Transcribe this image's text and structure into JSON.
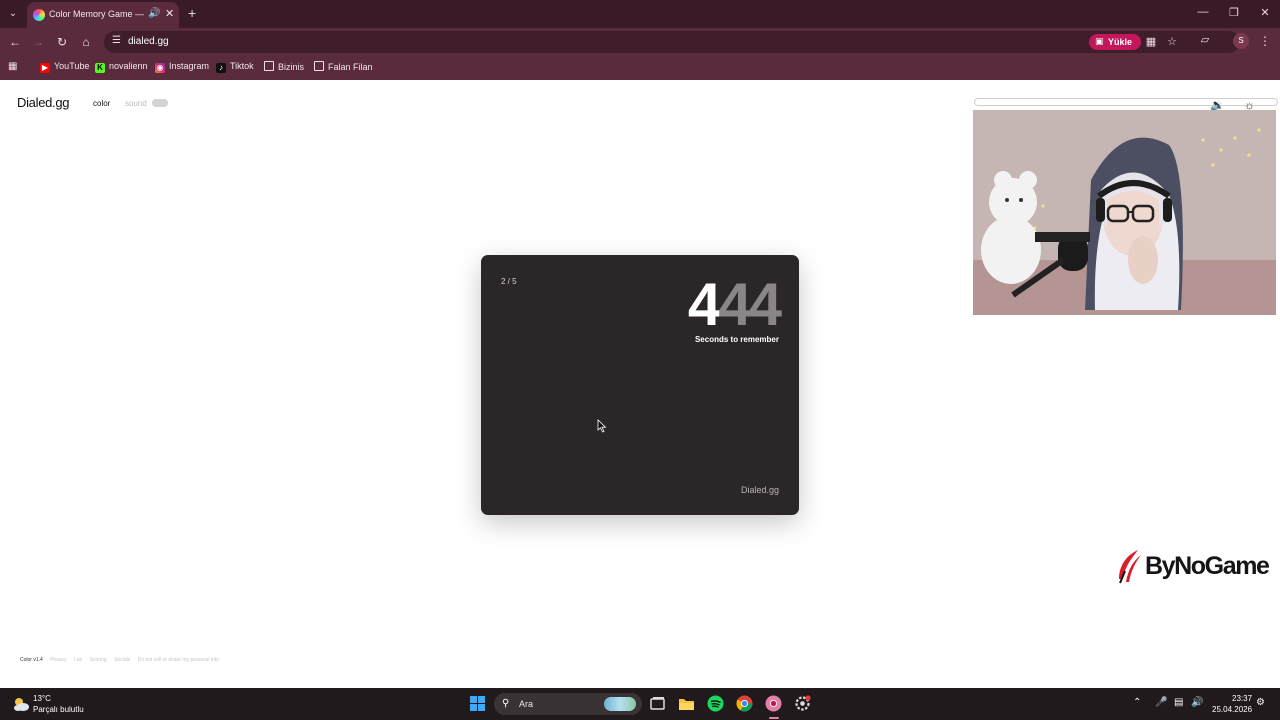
{
  "browser": {
    "tab_title": "Color Memory Game — Ho",
    "url": "dialed.gg",
    "yukle_label": "Yükle",
    "profile_initial": "S",
    "bookmarks": [
      {
        "label": "YouTube",
        "icon": "youtube-icon",
        "color": "#ff0000"
      },
      {
        "label": "novalienn",
        "icon": "kick-icon",
        "color": "#53fc18"
      },
      {
        "label": "Instagram",
        "icon": "instagram-icon",
        "color": "#e1306c"
      },
      {
        "label": "Tiktok",
        "icon": "tiktok-icon",
        "color": "#000000"
      },
      {
        "label": "Bizinis",
        "icon": "folder-icon",
        "color": "#f0e0e6"
      },
      {
        "label": "Falan Filan",
        "icon": "folder-icon",
        "color": "#f0e0e6"
      }
    ],
    "theme_color": "#5a2b3d",
    "accent_color": "#c2185b"
  },
  "page": {
    "logo": "Dialed.gg",
    "mode_color": "color",
    "mode_sound": "sound",
    "game": {
      "round": "2 / 5",
      "countdown_digits": [
        "4",
        "4",
        "4"
      ],
      "countdown_caption": "Seconds to remember",
      "brand": "Dialed.gg",
      "card_color": "#2b2628"
    },
    "footer": [
      "Color v1.4",
      "Privacy",
      "Lab",
      "Scoring",
      "Socials",
      "Do not sell or share my personal info"
    ]
  },
  "overlay": {
    "progress_fraction": 0.0,
    "sponsor_name": "ByNoGame"
  },
  "taskbar": {
    "weather_temp": "13°C",
    "weather_desc": "Parçalı bulutlu",
    "search_label": "Ara",
    "time": "23:37",
    "date": "25.04.2026"
  }
}
